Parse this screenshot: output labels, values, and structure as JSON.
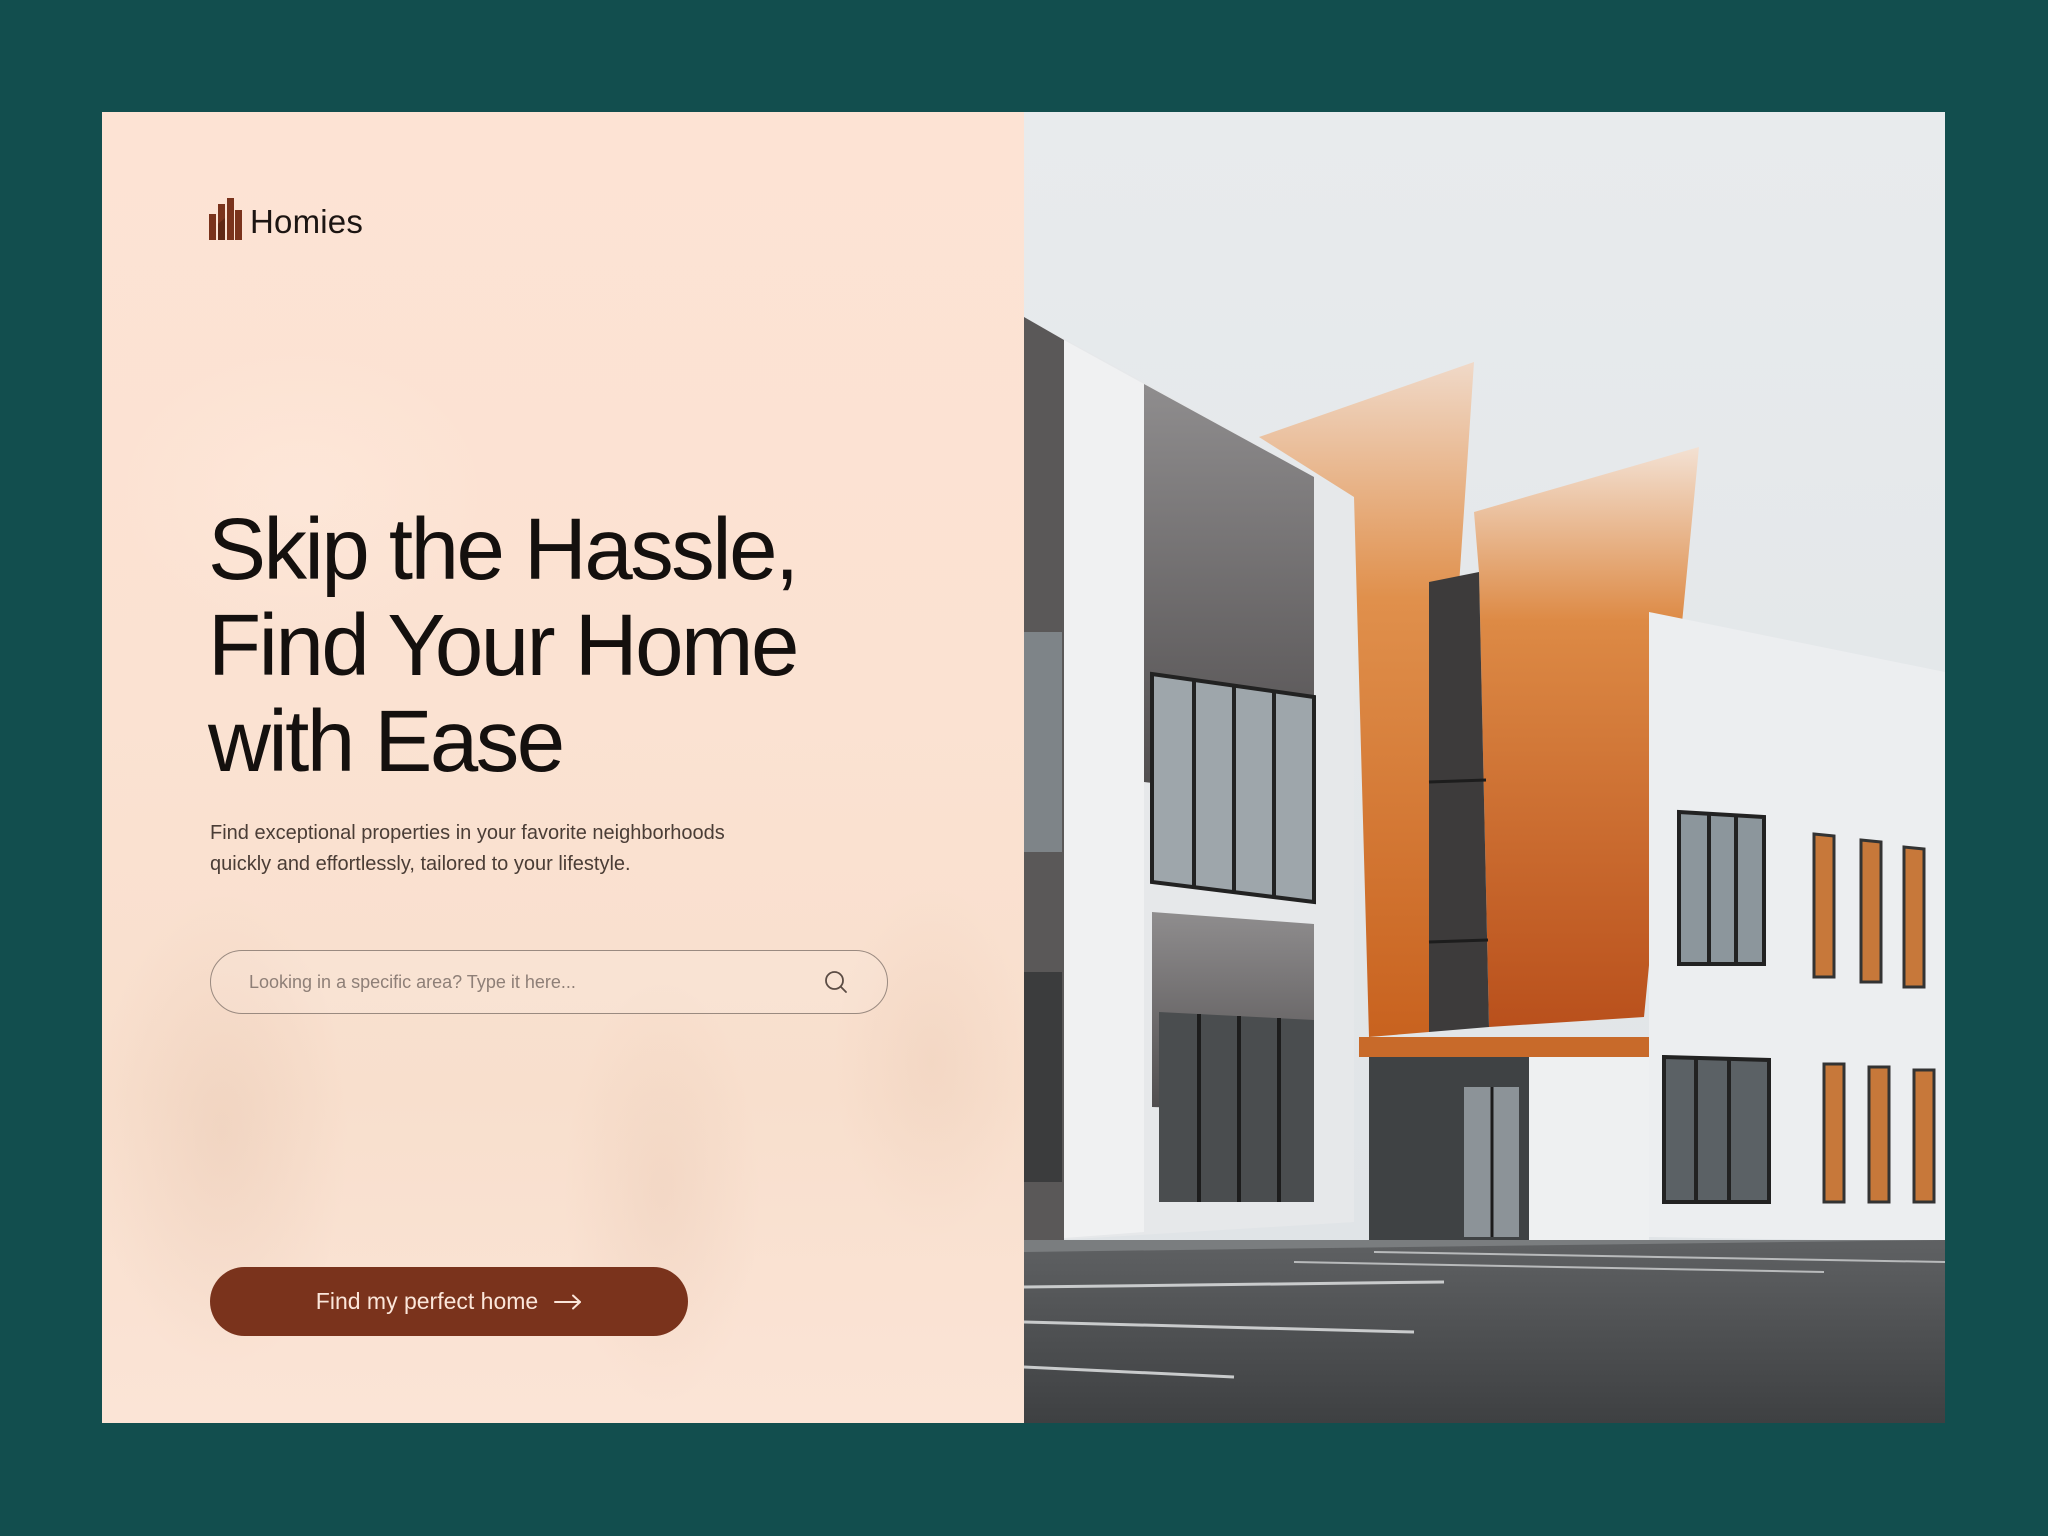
{
  "brand": {
    "name": "Homies",
    "icon": "building-bars-logo-icon",
    "color": "#7a331c"
  },
  "hero": {
    "title_lines": [
      "Skip the Hassle,",
      "Find Your Home",
      "with Ease"
    ],
    "subtitle_lines": [
      "Find exceptional properties in your favorite neighborhoods",
      "quickly and effortlessly, tailored to your lifestyle."
    ]
  },
  "search": {
    "placeholder": "Looking in a specific area? Type it here...",
    "value": "",
    "icon": "search-icon"
  },
  "cta": {
    "label": "Find my perfect home",
    "icon": "arrow-right-icon",
    "background": "#7a331c"
  },
  "image": {
    "subject": "modern-building-photo"
  },
  "colors": {
    "page_background": "#124e4e",
    "left_panel": "#fce2d3",
    "text": "#14100e",
    "accent": "#7a331c"
  }
}
